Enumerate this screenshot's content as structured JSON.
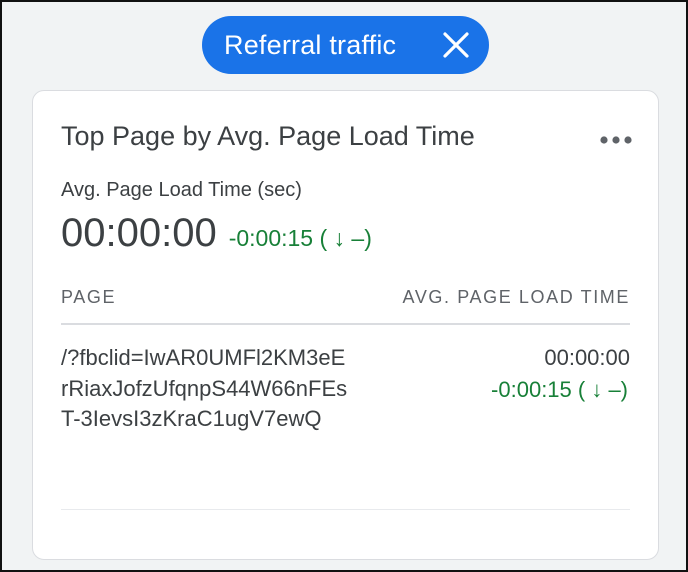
{
  "filter_chip": {
    "label": "Referral traffic",
    "close_icon": "close-icon",
    "color": "#1a73e8"
  },
  "card": {
    "title": "Top Page by Avg. Page Load Time",
    "more_icon": "more-horizontal-icon",
    "metric": {
      "label": "Avg. Page Load Time (sec)",
      "value": "00:00:00",
      "delta": "-0:00:15 ( ↓ –)",
      "delta_color": "#188038"
    },
    "table": {
      "columns": [
        "PAGE",
        "AVG. PAGE LOAD TIME"
      ],
      "rows": [
        {
          "page": "/?fbclid=IwAR0UMFl2KM3eErRiaxJofzUfqnpS44W66nFEsT-3IevsI3zKraC1ugV7ewQ",
          "value": "00:00:00",
          "delta": "-0:00:15 ( ↓ –)"
        }
      ]
    }
  }
}
